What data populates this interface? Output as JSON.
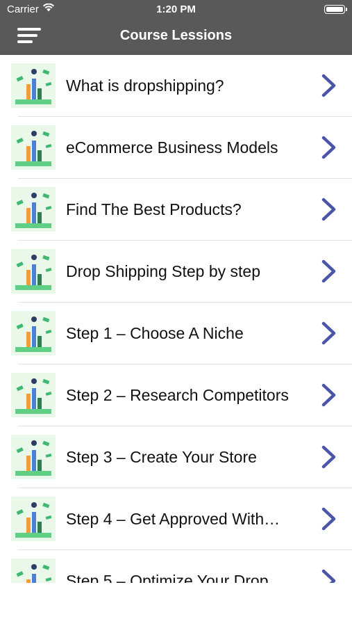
{
  "status_bar": {
    "carrier": "Carrier",
    "time": "1:20 PM"
  },
  "nav": {
    "title": "Course Lessions",
    "menu_icon": "hamburger-menu-icon"
  },
  "colors": {
    "header_bg": "#595959",
    "chevron": "#4a55a8",
    "separator": "#e2e2e2"
  },
  "lessons": [
    {
      "title": "What is dropshipping?"
    },
    {
      "title": "eCommerce Business Models"
    },
    {
      "title": "Find The Best Products?"
    },
    {
      "title": "Drop Shipping Step by step"
    },
    {
      "title": "Step 1 – Choose A Niche"
    },
    {
      "title": "Step 2 – Research Competitors"
    },
    {
      "title": "Step 3 – Create Your Store"
    },
    {
      "title": "Step 4 – Get Approved With…"
    },
    {
      "title": "Step 5 – Optimize Your Drop"
    }
  ]
}
